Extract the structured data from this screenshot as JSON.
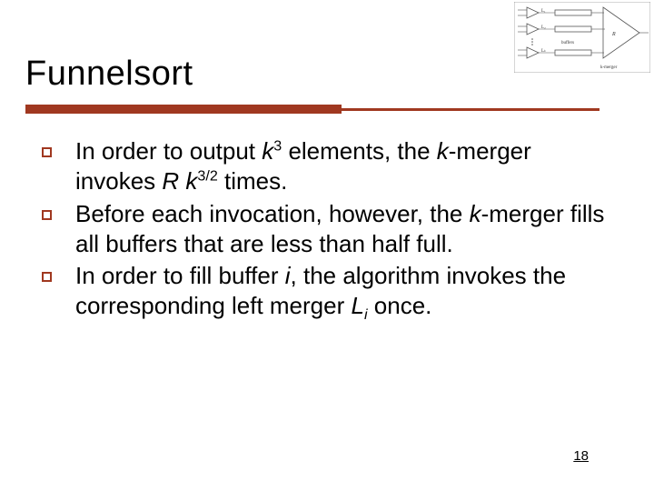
{
  "title": "Funnelsort",
  "bullets": [
    {
      "pre": "In order to output ",
      "var1": "k",
      "sup1": "3",
      "mid1": " elements, the ",
      "var2": "k",
      "mid2": "-merger invokes ",
      "var3": "R k",
      "sup2": "3/2",
      "post": " times."
    },
    {
      "pre": "Before each invocation, however, the ",
      "var1": "k",
      "post": "-merger fills all buffers that are less than half full."
    },
    {
      "pre": "In order to fill buffer ",
      "var1": "i",
      "mid1": ", the algorithm invokes the corresponding left merger ",
      "var2": "L",
      "sub1": "i",
      "post": " once."
    }
  ],
  "page_number": "18",
  "diagram": {
    "labels": {
      "l1": "L₁",
      "l2": "L₂",
      "lk": "Lₖ",
      "buf": "buffers",
      "r": "R",
      "km": "k-merger"
    }
  }
}
